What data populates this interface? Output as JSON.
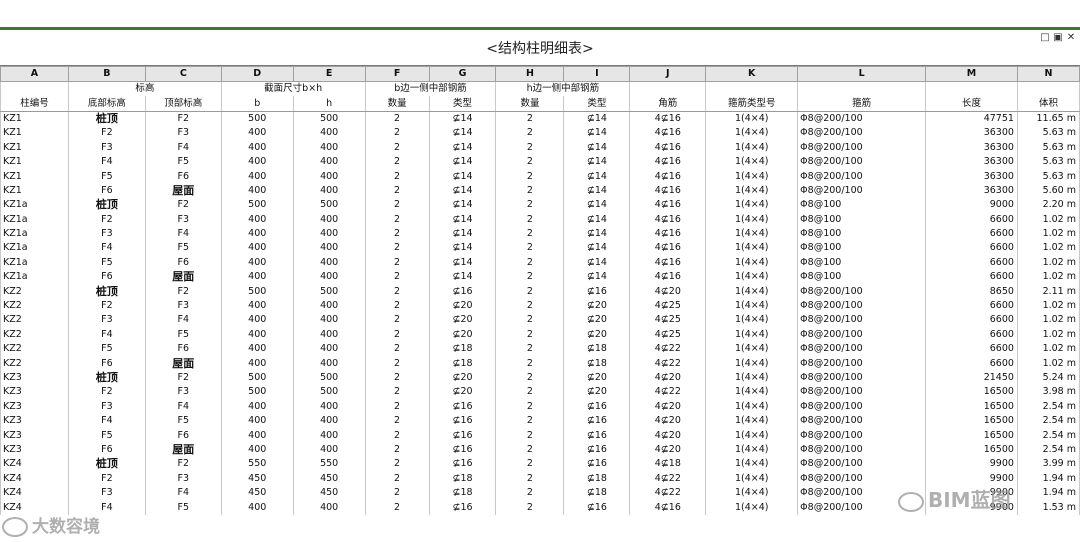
{
  "window": {
    "title": "<结构柱明细表>",
    "controls": {
      "minimize": "□",
      "restore": "▣",
      "close": "✕"
    }
  },
  "columns": [
    "A",
    "B",
    "C",
    "D",
    "E",
    "F",
    "G",
    "H",
    "I",
    "J",
    "K",
    "L",
    "M",
    "N"
  ],
  "headers": {
    "group_row": {
      "biaogao": "标高",
      "section": "截面尺寸b×h",
      "b_side": "b边一侧中部钢筋",
      "h_side": "h边一侧中部钢筋"
    },
    "sub_row": {
      "col_id": "柱编号",
      "bottom": "底部标高",
      "top": "顶部标高",
      "b": "b",
      "h": "h",
      "b_count": "数量",
      "b_type": "类型",
      "h_count": "数量",
      "h_type": "类型",
      "corner": "角筋",
      "stirrup_type": "箍筋类型号",
      "stirrup": "箍筋",
      "length": "长度",
      "volume": "体积"
    }
  },
  "rows": [
    [
      "KZ1",
      "桩顶",
      "F2",
      "500",
      "500",
      "2",
      "⊈14",
      "2",
      "⊈14",
      "4⊈16",
      "1(4×4)",
      "Φ8@200/100",
      "47751",
      "11.65 m"
    ],
    [
      "KZ1",
      "F2",
      "F3",
      "400",
      "400",
      "2",
      "⊈14",
      "2",
      "⊈14",
      "4⊈16",
      "1(4×4)",
      "Φ8@200/100",
      "36300",
      "5.63 m"
    ],
    [
      "KZ1",
      "F3",
      "F4",
      "400",
      "400",
      "2",
      "⊈14",
      "2",
      "⊈14",
      "4⊈16",
      "1(4×4)",
      "Φ8@200/100",
      "36300",
      "5.63 m"
    ],
    [
      "KZ1",
      "F4",
      "F5",
      "400",
      "400",
      "2",
      "⊈14",
      "2",
      "⊈14",
      "4⊈16",
      "1(4×4)",
      "Φ8@200/100",
      "36300",
      "5.63 m"
    ],
    [
      "KZ1",
      "F5",
      "F6",
      "400",
      "400",
      "2",
      "⊈14",
      "2",
      "⊈14",
      "4⊈16",
      "1(4×4)",
      "Φ8@200/100",
      "36300",
      "5.63 m"
    ],
    [
      "KZ1",
      "F6",
      "屋面",
      "400",
      "400",
      "2",
      "⊈14",
      "2",
      "⊈14",
      "4⊈16",
      "1(4×4)",
      "Φ8@200/100",
      "36300",
      "5.60 m"
    ],
    [
      "KZ1a",
      "桩顶",
      "F2",
      "500",
      "500",
      "2",
      "⊈14",
      "2",
      "⊈14",
      "4⊈16",
      "1(4×4)",
      "Φ8@100",
      "9000",
      "2.20 m"
    ],
    [
      "KZ1a",
      "F2",
      "F3",
      "400",
      "400",
      "2",
      "⊈14",
      "2",
      "⊈14",
      "4⊈16",
      "1(4×4)",
      "Φ8@100",
      "6600",
      "1.02 m"
    ],
    [
      "KZ1a",
      "F3",
      "F4",
      "400",
      "400",
      "2",
      "⊈14",
      "2",
      "⊈14",
      "4⊈16",
      "1(4×4)",
      "Φ8@100",
      "6600",
      "1.02 m"
    ],
    [
      "KZ1a",
      "F4",
      "F5",
      "400",
      "400",
      "2",
      "⊈14",
      "2",
      "⊈14",
      "4⊈16",
      "1(4×4)",
      "Φ8@100",
      "6600",
      "1.02 m"
    ],
    [
      "KZ1a",
      "F5",
      "F6",
      "400",
      "400",
      "2",
      "⊈14",
      "2",
      "⊈14",
      "4⊈16",
      "1(4×4)",
      "Φ8@100",
      "6600",
      "1.02 m"
    ],
    [
      "KZ1a",
      "F6",
      "屋面",
      "400",
      "400",
      "2",
      "⊈14",
      "2",
      "⊈14",
      "4⊈16",
      "1(4×4)",
      "Φ8@100",
      "6600",
      "1.02 m"
    ],
    [
      "KZ2",
      "桩顶",
      "F2",
      "500",
      "500",
      "2",
      "⊈16",
      "2",
      "⊈16",
      "4⊈20",
      "1(4×4)",
      "Φ8@200/100",
      "8650",
      "2.11 m"
    ],
    [
      "KZ2",
      "F2",
      "F3",
      "400",
      "400",
      "2",
      "⊈20",
      "2",
      "⊈20",
      "4⊈25",
      "1(4×4)",
      "Φ8@200/100",
      "6600",
      "1.02 m"
    ],
    [
      "KZ2",
      "F3",
      "F4",
      "400",
      "400",
      "2",
      "⊈20",
      "2",
      "⊈20",
      "4⊈25",
      "1(4×4)",
      "Φ8@200/100",
      "6600",
      "1.02 m"
    ],
    [
      "KZ2",
      "F4",
      "F5",
      "400",
      "400",
      "2",
      "⊈20",
      "2",
      "⊈20",
      "4⊈25",
      "1(4×4)",
      "Φ8@200/100",
      "6600",
      "1.02 m"
    ],
    [
      "KZ2",
      "F5",
      "F6",
      "400",
      "400",
      "2",
      "⊈18",
      "2",
      "⊈18",
      "4⊈22",
      "1(4×4)",
      "Φ8@200/100",
      "6600",
      "1.02 m"
    ],
    [
      "KZ2",
      "F6",
      "屋面",
      "400",
      "400",
      "2",
      "⊈18",
      "2",
      "⊈18",
      "4⊈22",
      "1(4×4)",
      "Φ8@200/100",
      "6600",
      "1.02 m"
    ],
    [
      "KZ3",
      "桩顶",
      "F2",
      "500",
      "500",
      "2",
      "⊈20",
      "2",
      "⊈20",
      "4⊈20",
      "1(4×4)",
      "Φ8@200/100",
      "21450",
      "5.24 m"
    ],
    [
      "KZ3",
      "F2",
      "F3",
      "500",
      "500",
      "2",
      "⊈20",
      "2",
      "⊈20",
      "4⊈22",
      "1(4×4)",
      "Φ8@200/100",
      "16500",
      "3.98 m"
    ],
    [
      "KZ3",
      "F3",
      "F4",
      "400",
      "400",
      "2",
      "⊈16",
      "2",
      "⊈16",
      "4⊈20",
      "1(4×4)",
      "Φ8@200/100",
      "16500",
      "2.54 m"
    ],
    [
      "KZ3",
      "F4",
      "F5",
      "400",
      "400",
      "2",
      "⊈16",
      "2",
      "⊈16",
      "4⊈20",
      "1(4×4)",
      "Φ8@200/100",
      "16500",
      "2.54 m"
    ],
    [
      "KZ3",
      "F5",
      "F6",
      "400",
      "400",
      "2",
      "⊈16",
      "2",
      "⊈16",
      "4⊈20",
      "1(4×4)",
      "Φ8@200/100",
      "16500",
      "2.54 m"
    ],
    [
      "KZ3",
      "F6",
      "屋面",
      "400",
      "400",
      "2",
      "⊈16",
      "2",
      "⊈16",
      "4⊈20",
      "1(4×4)",
      "Φ8@200/100",
      "16500",
      "2.54 m"
    ],
    [
      "KZ4",
      "桩顶",
      "F2",
      "550",
      "550",
      "2",
      "⊈16",
      "2",
      "⊈16",
      "4⊈18",
      "1(4×4)",
      "Φ8@200/100",
      "9900",
      "3.99 m"
    ],
    [
      "KZ4",
      "F2",
      "F3",
      "450",
      "450",
      "2",
      "⊈18",
      "2",
      "⊈18",
      "4⊈22",
      "1(4×4)",
      "Φ8@200/100",
      "9900",
      "1.94 m"
    ],
    [
      "KZ4",
      "F3",
      "F4",
      "450",
      "450",
      "2",
      "⊈18",
      "2",
      "⊈18",
      "4⊈22",
      "1(4×4)",
      "Φ8@200/100",
      "9900",
      "1.94 m"
    ],
    [
      "KZ4",
      "F4",
      "F5",
      "400",
      "400",
      "2",
      "⊈16",
      "2",
      "⊈16",
      "4⊈16",
      "1(4×4)",
      "Φ8@200/100",
      "9900",
      "1.53 m"
    ]
  ],
  "watermarks": {
    "left": "大数容境",
    "right": "BIM蓝图"
  }
}
